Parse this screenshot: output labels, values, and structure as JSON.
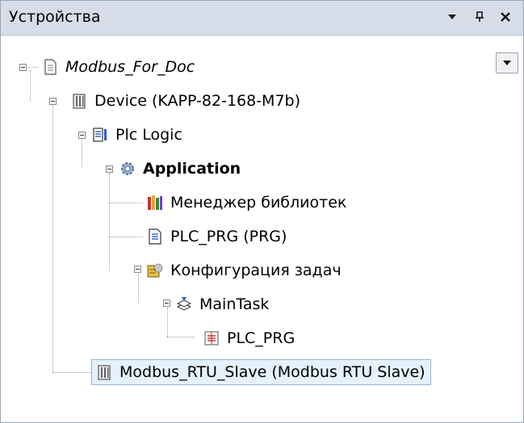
{
  "panel": {
    "title": "Устройства",
    "buttons": [
      "dropdown-icon",
      "pin-icon",
      "close-icon"
    ]
  },
  "tree": {
    "nodes": [
      {
        "label": "Modbus_For_Doc",
        "icon": "project-icon",
        "style": "italic"
      },
      {
        "label": "Device (KAPP-82-168-M7b)",
        "icon": "device-icon"
      },
      {
        "label": "Plc Logic",
        "icon": "plc-logic-icon"
      },
      {
        "label": "Application",
        "icon": "application-gear-icon",
        "style": "bold"
      },
      {
        "label": "Менеджер библиотек",
        "icon": "library-manager-icon"
      },
      {
        "label": "PLC_PRG (PRG)",
        "icon": "pou-icon"
      },
      {
        "label": "Конфигурация задач",
        "icon": "task-config-icon"
      },
      {
        "label": "MainTask",
        "icon": "task-icon"
      },
      {
        "label": "PLC_PRG",
        "icon": "program-call-icon"
      },
      {
        "label": "Modbus_RTU_Slave (Modbus RTU Slave)",
        "icon": "device-icon",
        "selected": true
      }
    ]
  },
  "colors": {
    "titlebar": "#d7dde8",
    "selection_bg": "#e5f1fb",
    "selection_border": "#8db7e3"
  }
}
